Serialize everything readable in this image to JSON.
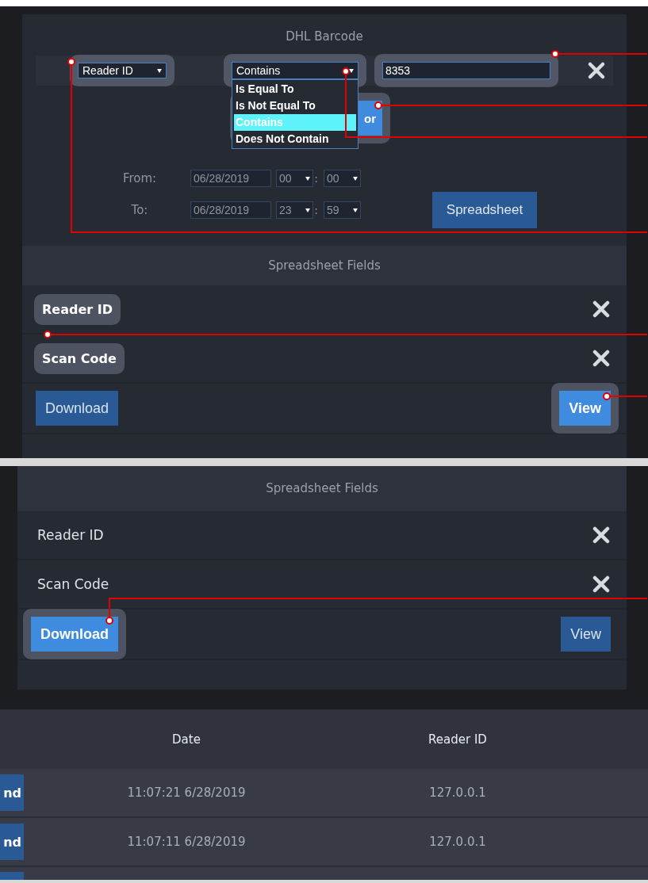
{
  "panel_1": {
    "title": "DHL Barcode",
    "filter": {
      "field": {
        "value": "Reader ID",
        "highlighted": true
      },
      "operator": {
        "value": "Contains",
        "highlighted": true,
        "expanded": true,
        "options": [
          {
            "label": "Is Equal To",
            "selected": false
          },
          {
            "label": "Is Not Equal To",
            "selected": false
          },
          {
            "label": "Contains",
            "selected": true
          },
          {
            "label": "Does Not Contain",
            "selected": false
          }
        ]
      },
      "value_field": {
        "value": "8353",
        "highlighted": true
      },
      "covered_button": {
        "label": "or",
        "highlighted": true
      }
    },
    "from": {
      "label": "From:",
      "date": "06/28/2019",
      "hour": "00",
      "separator": ":",
      "minute": "00"
    },
    "to": {
      "label": "To:",
      "date": "06/28/2019",
      "hour": "23",
      "separator": ":",
      "minute": "59"
    },
    "spreadsheet_button": "Spreadsheet",
    "fields_header": "Spreadsheet Fields",
    "fields": [
      {
        "label": "Reader ID",
        "highlighted": true
      },
      {
        "label": "Scan Code",
        "highlighted": true
      }
    ],
    "buttons": [
      {
        "label": "Download",
        "active": false,
        "highlighted": false
      },
      {
        "label": "View",
        "active": true,
        "highlighted": true
      }
    ]
  },
  "panel_2": {
    "fields_header": "Spreadsheet Fields",
    "fields": [
      {
        "label": "Reader ID",
        "highlighted": false
      },
      {
        "label": "Scan Code",
        "highlighted": false
      }
    ],
    "buttons": [
      {
        "label": "Download",
        "active": true,
        "highlighted": true
      },
      {
        "label": "View",
        "active": false,
        "highlighted": false
      }
    ]
  },
  "table": {
    "columns": [
      "Date",
      "Reader ID"
    ],
    "rows": [
      {
        "button": "nd",
        "date": "11:07:21 6/28/2019",
        "reader_id": "127.0.0.1"
      },
      {
        "button": "nd",
        "date": "11:07:11 6/28/2019",
        "reader_id": "127.0.0.1"
      }
    ]
  }
}
